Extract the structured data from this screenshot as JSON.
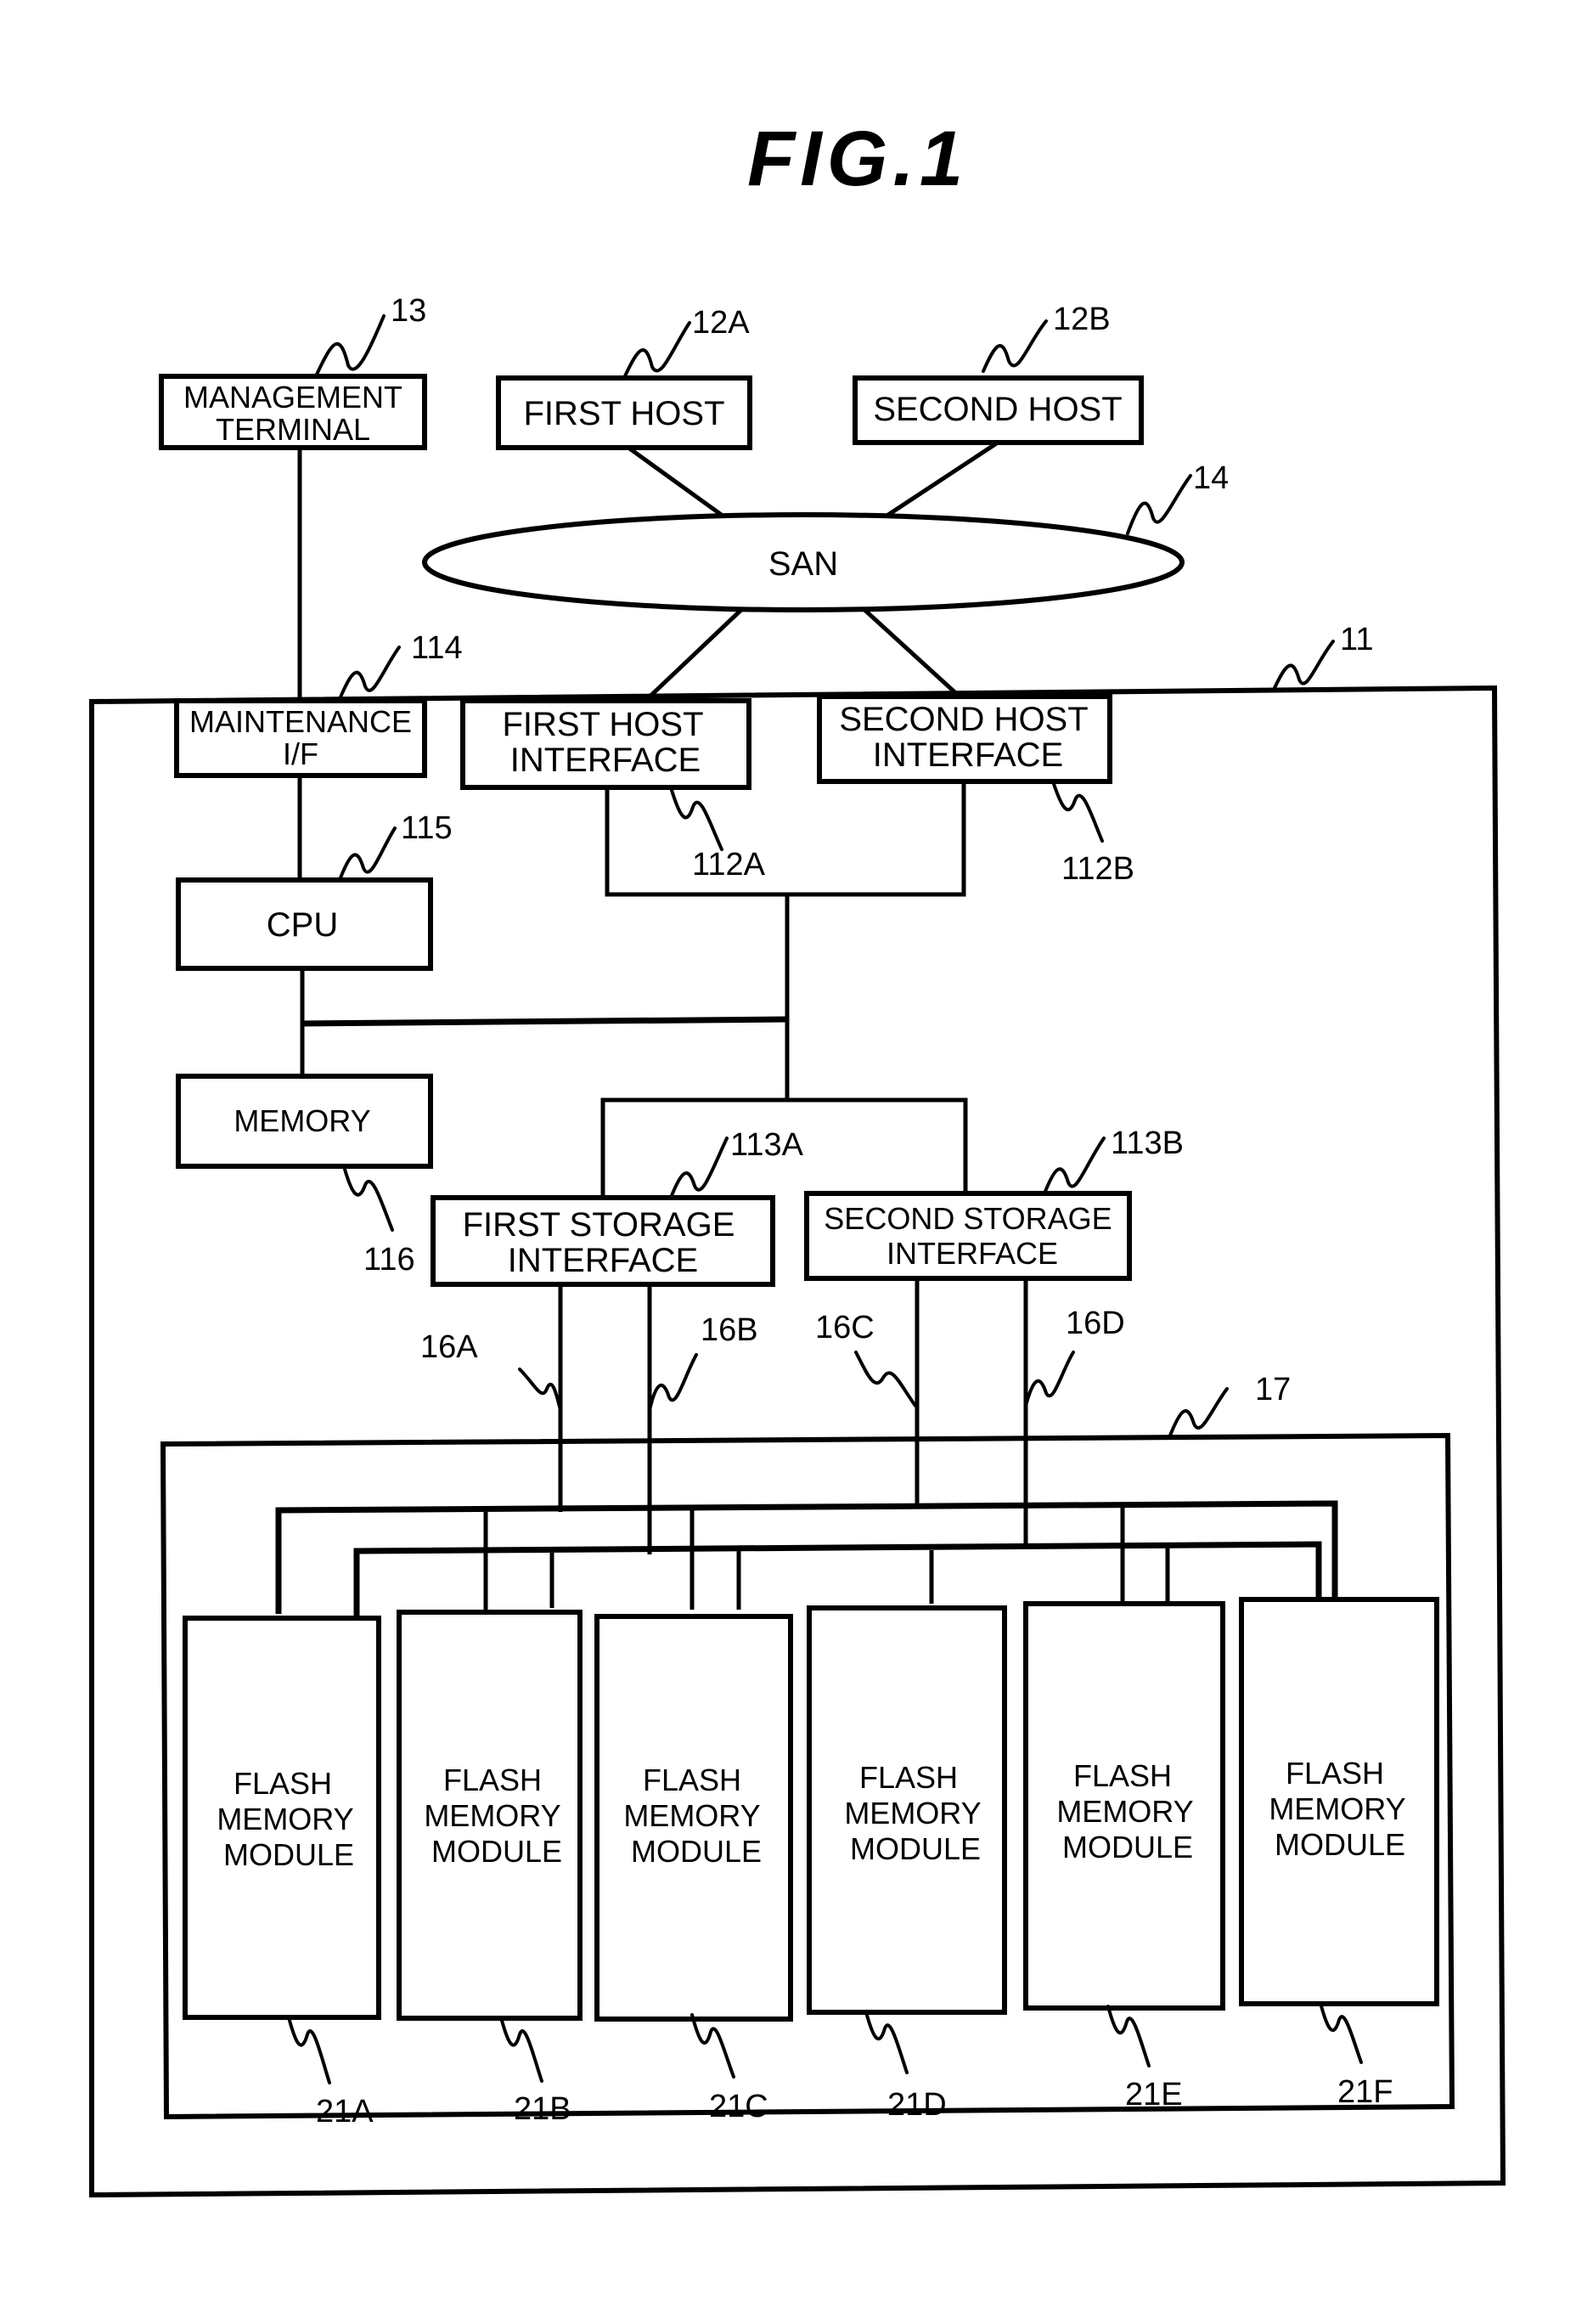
{
  "figure": {
    "title": "FIG.1"
  },
  "nodes": {
    "management_terminal": {
      "lines": [
        "MANAGEMENT",
        "TERMINAL"
      ],
      "ref": "13"
    },
    "first_host": {
      "lines": [
        "FIRST HOST"
      ],
      "ref": "12A"
    },
    "second_host": {
      "lines": [
        "SECOND HOST"
      ],
      "ref": "12B"
    },
    "san": {
      "lines": [
        "SAN"
      ],
      "ref": "14"
    },
    "storage_system": {
      "ref": "11"
    },
    "maintenance_if": {
      "lines": [
        "MAINTENANCE",
        "I/F"
      ],
      "ref": "114"
    },
    "first_host_interface": {
      "lines": [
        "FIRST HOST",
        "INTERFACE"
      ],
      "ref": "112A"
    },
    "second_host_interface": {
      "lines": [
        "SECOND HOST",
        "INTERFACE"
      ],
      "ref": "112B"
    },
    "cpu": {
      "lines": [
        "CPU"
      ],
      "ref": "115"
    },
    "memory": {
      "lines": [
        "MEMORY"
      ],
      "ref": "116"
    },
    "first_storage_interface": {
      "lines": [
        "FIRST STORAGE",
        "INTERFACE"
      ],
      "ref": "113A"
    },
    "second_storage_interface": {
      "lines": [
        "SECOND STORAGE",
        "INTERFACE"
      ],
      "ref": "113B"
    },
    "flash_enclosure": {
      "ref": "17"
    },
    "paths": {
      "a": "16A",
      "b": "16B",
      "c": "16C",
      "d": "16D"
    },
    "flash_modules": [
      {
        "lines": [
          "FLASH",
          "MEMORY",
          "MODULE"
        ],
        "ref": "21A"
      },
      {
        "lines": [
          "FLASH",
          "MEMORY",
          "MODULE"
        ],
        "ref": "21B"
      },
      {
        "lines": [
          "FLASH",
          "MEMORY",
          "MODULE"
        ],
        "ref": "21C"
      },
      {
        "lines": [
          "FLASH",
          "MEMORY",
          "MODULE"
        ],
        "ref": "21D"
      },
      {
        "lines": [
          "FLASH",
          "MEMORY",
          "MODULE"
        ],
        "ref": "21E"
      },
      {
        "lines": [
          "FLASH",
          "MEMORY",
          "MODULE"
        ],
        "ref": "21F"
      }
    ]
  }
}
